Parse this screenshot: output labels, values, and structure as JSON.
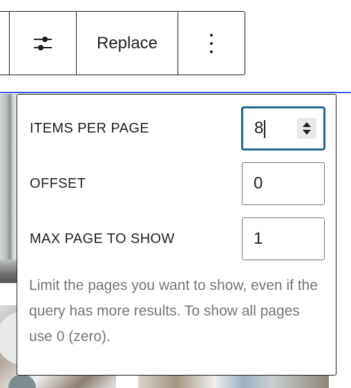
{
  "toolbar": {
    "settings_icon": "sliders-icon",
    "replace_label": "Replace",
    "more_icon": "vertical-ellipsis-icon"
  },
  "popover": {
    "fields": [
      {
        "label": "ITEMS PER PAGE",
        "value": "8",
        "focused": true,
        "spinner": true
      },
      {
        "label": "OFFSET",
        "value": "0"
      },
      {
        "label": "MAX PAGE TO SHOW",
        "value": "1"
      }
    ],
    "help_text": "Limit the pages you want to show, even if the query has more results. To show all pages use 0 (zero)."
  },
  "colors": {
    "accent": "#3858e9",
    "focus": "#1e6a8e",
    "text": "#1e1e1e",
    "muted": "#757575"
  }
}
